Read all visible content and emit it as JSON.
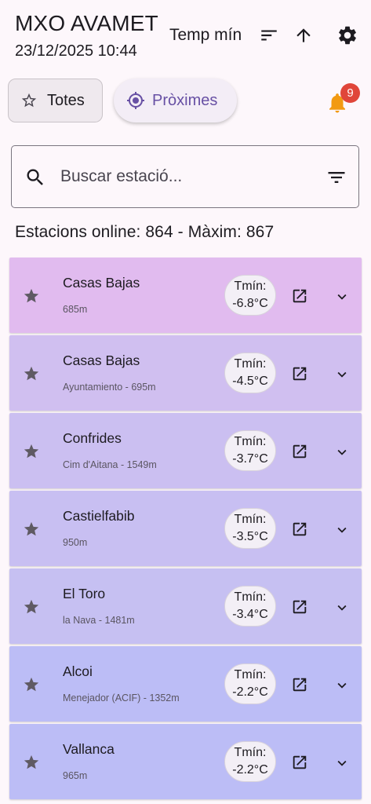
{
  "header": {
    "title": "MXO AVAMET",
    "datetime": "23/12/2025 10:44",
    "sort_label": "Temp mín"
  },
  "chips": {
    "all_label": "Totes",
    "nearby_label": "Pròximes"
  },
  "notifications": {
    "count": "9"
  },
  "search": {
    "placeholder": "Buscar estació..."
  },
  "status": {
    "online_text": "Estacions online: 864 - Màxim: 867"
  },
  "stations": [
    {
      "name": "Casas Bajas",
      "subtitle": "685m",
      "tmin_label": "Tmín:",
      "tmin_value": "-6.8°C",
      "color": "#e1bbef"
    },
    {
      "name": "Casas Bajas",
      "subtitle": "Ayuntamiento - 695m",
      "tmin_label": "Tmín:",
      "tmin_value": "-4.5°C",
      "color": "#d0bff0"
    },
    {
      "name": "Confrides",
      "subtitle": "Cim d'Aitana - 1549m",
      "tmin_label": "Tmín:",
      "tmin_value": "-3.7°C",
      "color": "#cbbff1"
    },
    {
      "name": "Castielfabib",
      "subtitle": "950m",
      "tmin_label": "Tmín:",
      "tmin_value": "-3.5°C",
      "color": "#c8bff2"
    },
    {
      "name": "El Toro",
      "subtitle": "la Nava - 1481m",
      "tmin_label": "Tmín:",
      "tmin_value": "-3.4°C",
      "color": "#c6c0f2"
    },
    {
      "name": "Alcoi",
      "subtitle": "Menejador (ACIF) - 1352m",
      "tmin_label": "Tmín:",
      "tmin_value": "-2.2°C",
      "color": "#bcbdf6"
    },
    {
      "name": "Vallanca",
      "subtitle": "965m",
      "tmin_label": "Tmín:",
      "tmin_value": "-2.2°C",
      "color": "#bcbdf6"
    }
  ],
  "icons": {
    "sort": "sort-icon",
    "arrow": "arrow-up-icon",
    "settings": "gear-icon",
    "star_outline": "star-outline-icon",
    "nearby": "my-location-icon",
    "bell": "bell-icon",
    "search": "search-icon",
    "filter": "filter-icon",
    "favorite": "star-icon",
    "open": "open-in-new-icon",
    "expand": "chevron-down-icon"
  },
  "colors": {
    "accent": "#6750a4",
    "bell": "#f29a12",
    "badge": "#e0463a",
    "background": "#fdf7fb"
  }
}
